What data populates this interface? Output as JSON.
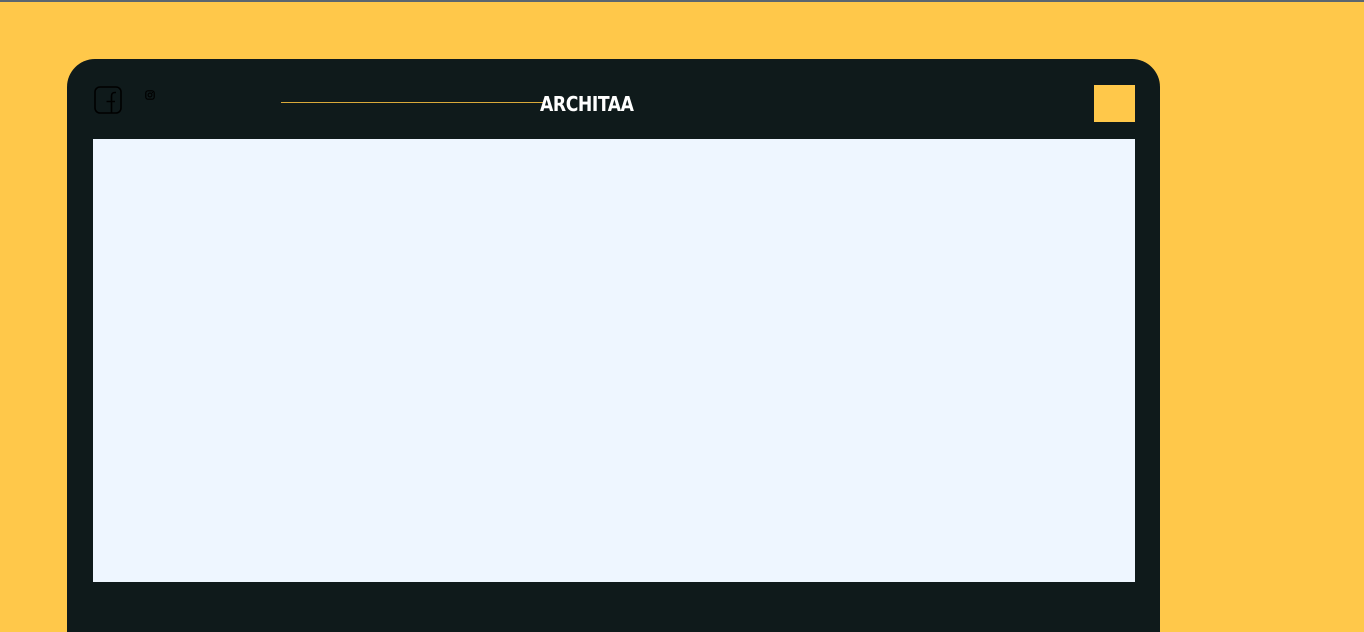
{
  "header": {
    "brand": "ARCHITAA"
  },
  "social": [
    {
      "icon": "facebook-icon"
    },
    {
      "icon": "instagram-icon"
    }
  ],
  "menu": {
    "icon": "menu-square"
  },
  "colors": {
    "background": "#FFC84A",
    "frame": "#0F1A1B",
    "screen": "#EEF6FF",
    "accent": "#FFC84A",
    "brand_text": "#FFFFFF",
    "line": "#D9A93A"
  }
}
